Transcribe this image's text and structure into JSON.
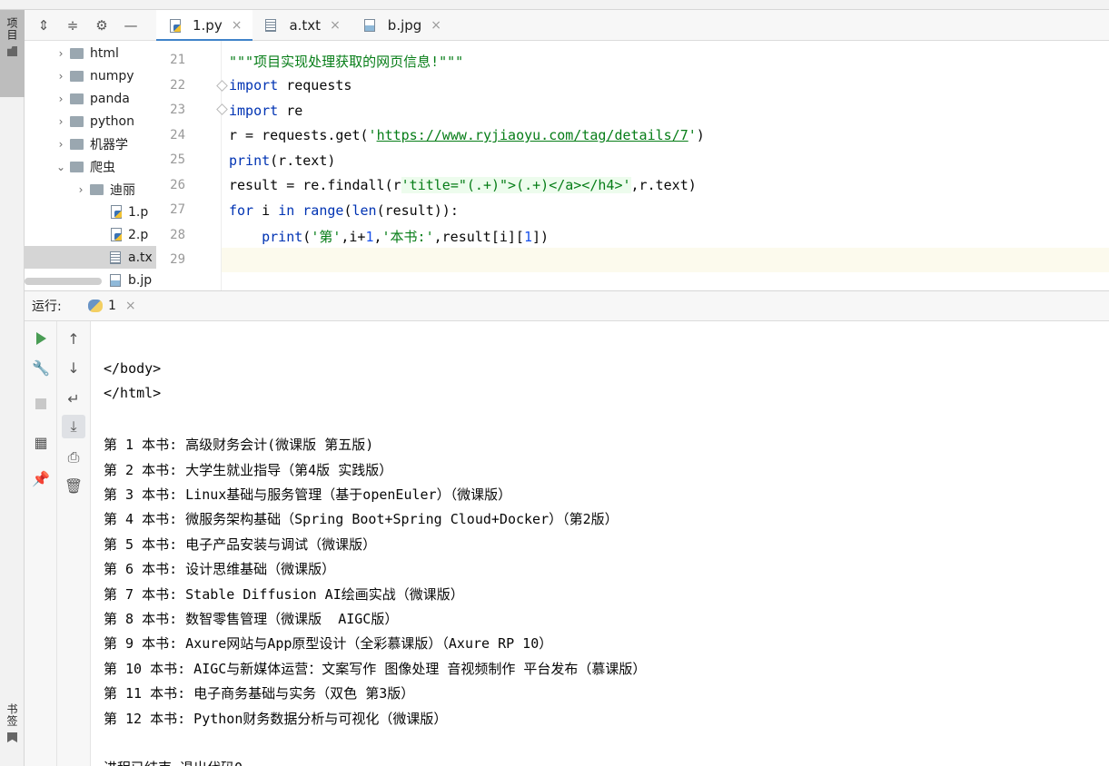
{
  "top_sliver": {
    "text": "ру"
  },
  "left_strip": {
    "project_tab": "项目",
    "bookmarks_tab": "书签"
  },
  "project_tree": {
    "items": [
      {
        "label": "html",
        "kind": "folder",
        "expander": "›"
      },
      {
        "label": "numpy",
        "kind": "folder",
        "expander": "›"
      },
      {
        "label": "panda",
        "kind": "folder",
        "expander": "›"
      },
      {
        "label": "python",
        "kind": "folder",
        "expander": "›"
      },
      {
        "label": "机器学",
        "kind": "folder",
        "expander": "›"
      },
      {
        "label": "爬虫",
        "kind": "folder",
        "expander": "⌄"
      },
      {
        "label": "迪丽",
        "kind": "folder",
        "expander": "›"
      },
      {
        "label": "1.p",
        "kind": "py"
      },
      {
        "label": "2.p",
        "kind": "py"
      },
      {
        "label": "a.tx",
        "kind": "txt"
      },
      {
        "label": "b.jp",
        "kind": "img"
      }
    ]
  },
  "editor_tabs": [
    {
      "label": "1.py",
      "active": true
    },
    {
      "label": "a.txt",
      "active": false
    },
    {
      "label": "b.jpg",
      "active": false
    }
  ],
  "editor": {
    "line_numbers": [
      "21",
      "22",
      "23",
      "24",
      "25",
      "26",
      "27",
      "28",
      "29"
    ]
  },
  "run_panel": {
    "label": "运行:",
    "tab_label": "1"
  },
  "console": {
    "lines": [
      "</body>",
      "</html>",
      "",
      "第 1 本书: 高级财务会计(微课版 第五版)",
      "第 2 本书: 大学生就业指导（第4版 实践版）",
      "第 3 本书: Linux基础与服务管理（基于openEuler）（微课版）",
      "第 4 本书: 微服务架构基础（Spring Boot+Spring Cloud+Docker）（第2版）",
      "第 5 本书: 电子产品安装与调试（微课版）",
      "第 6 本书: 设计思维基础（微课版）",
      "第 7 本书: Stable Diffusion AI绘画实战（微课版）",
      "第 8 本书: 数智零售管理（微课版  AIGC版）",
      "第 9 本书: Axure网站与App原型设计（全彩慕课版）（Axure RP 10）",
      "第 10 本书: AIGC与新媒体运营：文案写作 图像处理 音视频制作 平台发布（慕课版）",
      "第 11 本书: 电子商务基础与实务（双色 第3版）",
      "第 12 本书: Python财务数据分析与可视化（微课版）",
      "",
      "进程已结束,退出代码0"
    ]
  },
  "colors": {
    "keyword": "#0033b3",
    "string": "#067d17",
    "number": "#1750eb",
    "active_tab_underline": "#4083c9",
    "run_green": "#499c54"
  }
}
